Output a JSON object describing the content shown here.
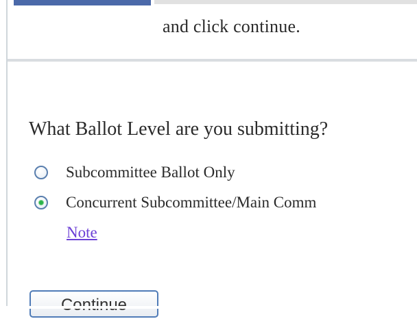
{
  "header": {
    "instruction_tail": "and click continue."
  },
  "form": {
    "question": "What Ballot Level are you submitting?",
    "options": [
      {
        "label": "Subcommittee Ballot Only",
        "selected": false
      },
      {
        "label": "Concurrent Subcommittee/Main Comm",
        "selected": true
      }
    ],
    "note_link": "Note",
    "continue_label": "Continue"
  },
  "colors": {
    "link": "#6b3fd6",
    "radio_selected_dot": "#2bb34a",
    "button_border": "#4f7bb7"
  }
}
